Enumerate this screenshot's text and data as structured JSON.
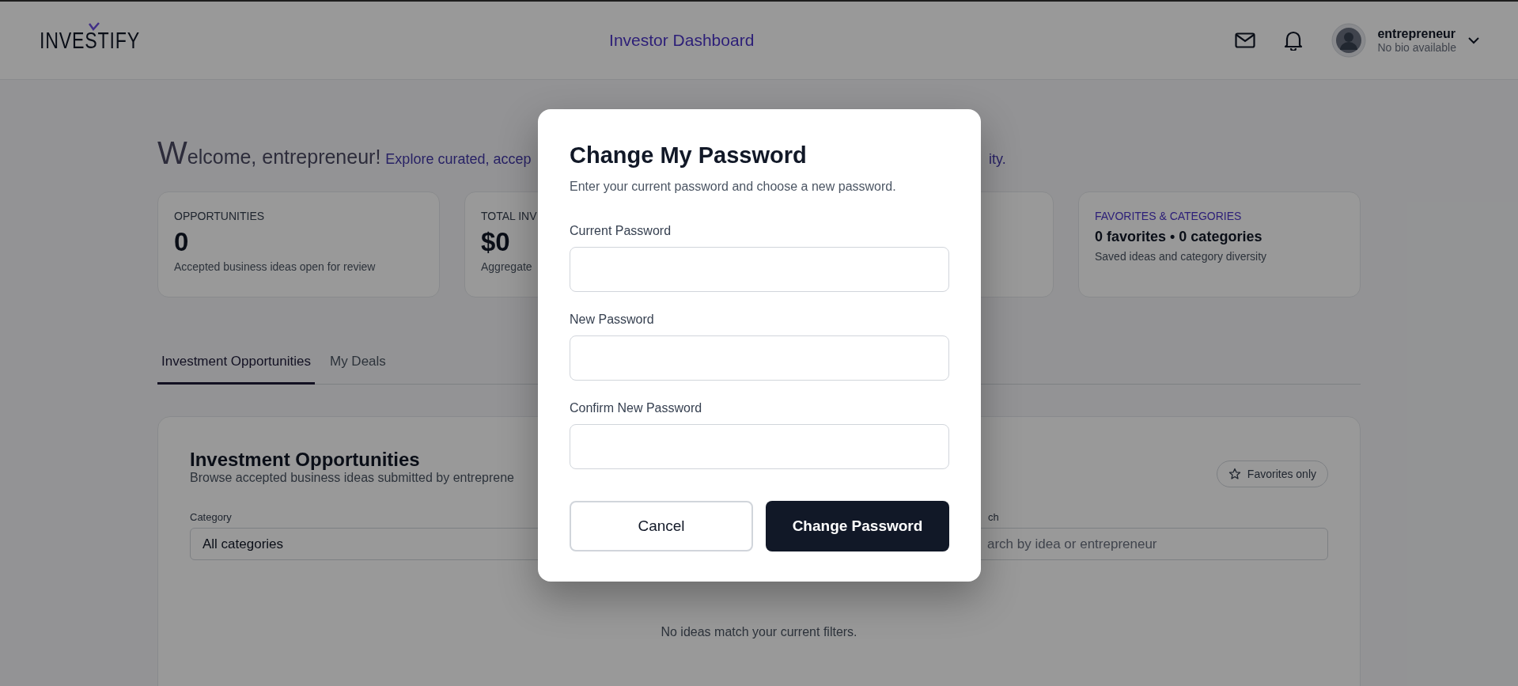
{
  "header": {
    "logo": "INVESTIFY",
    "title": "Investor Dashboard",
    "user": {
      "name": "entrepreneur",
      "bio": "No bio available"
    }
  },
  "welcome": {
    "greeting": "Welcome, entrepreneur!",
    "intro_start": "Explore curated, accep",
    "intro_end": "ity."
  },
  "stats": [
    {
      "label": "OPPORTUNITIES",
      "value": "0",
      "note": "Accepted business ideas open for review",
      "kind": "big"
    },
    {
      "label": "TOTAL INV",
      "value": "$0",
      "note": "Aggregate",
      "kind": "big"
    },
    {
      "kind": "hidden"
    },
    {
      "label": "FAVORITES & CATEGORIES",
      "value": "0 favorites • 0 categories",
      "note": "Saved ideas and category diversity",
      "kind": "accent"
    }
  ],
  "tabs": [
    {
      "label": "Investment Opportunities",
      "selected": true
    },
    {
      "label": "My Deals",
      "selected": false
    }
  ],
  "panel": {
    "title": "Investment Opportunities",
    "subtitle": "Browse accepted business ideas submitted by entreprene",
    "favorites_button": "Favorites only",
    "category": {
      "label": "Category",
      "value": "All categories"
    },
    "search": {
      "label": "ch",
      "placeholder": "arch by idea or entrepreneur"
    },
    "empty_message": "No ideas match your current filters."
  },
  "dialog": {
    "title": "Change My Password",
    "description": "Enter your current password and choose a new password.",
    "fields": [
      {
        "label": "Current Password"
      },
      {
        "label": "New Password"
      },
      {
        "label": "Confirm New Password"
      }
    ],
    "cancel": "Cancel",
    "submit": "Change Password"
  }
}
